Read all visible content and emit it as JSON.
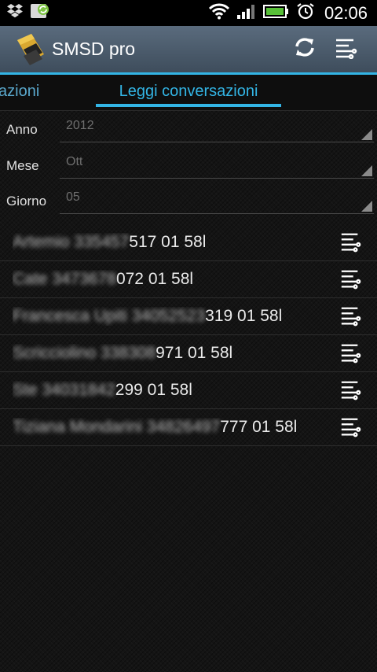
{
  "status_bar": {
    "time": "02:06",
    "icons": [
      "dropbox-icon",
      "sync-app-icon",
      "wifi-icon",
      "signal-icon",
      "battery-charging-icon",
      "alarm-icon"
    ]
  },
  "action_bar": {
    "title": "SMSD pro",
    "icons": [
      "sd-card-app-icon",
      "refresh-icon",
      "settings-sliders-icon"
    ],
    "accent_color": "#33b5e5"
  },
  "tabs": {
    "previous_partial": "azioni",
    "active": "Leggi conversazioni"
  },
  "filters": [
    {
      "label": "Anno",
      "value": "2012"
    },
    {
      "label": "Mese",
      "value": "Ott"
    },
    {
      "label": "Giorno",
      "value": "05"
    }
  ],
  "conversations": [
    {
      "blurred": "Artemio 335457",
      "visible": "517 01 58l"
    },
    {
      "blurred": "Cate 3473678",
      "visible": "072 01 58l"
    },
    {
      "blurred": "Francesca Upiti 34052523",
      "visible": "319 01 58l"
    },
    {
      "blurred": "Scricciolino 338308",
      "visible": "971 01 58l"
    },
    {
      "blurred": "Ste 34031842",
      "visible": "299 01 58l"
    },
    {
      "blurred": "Tiziana Mondarini 34826497",
      "visible": "777 01 58l"
    }
  ]
}
